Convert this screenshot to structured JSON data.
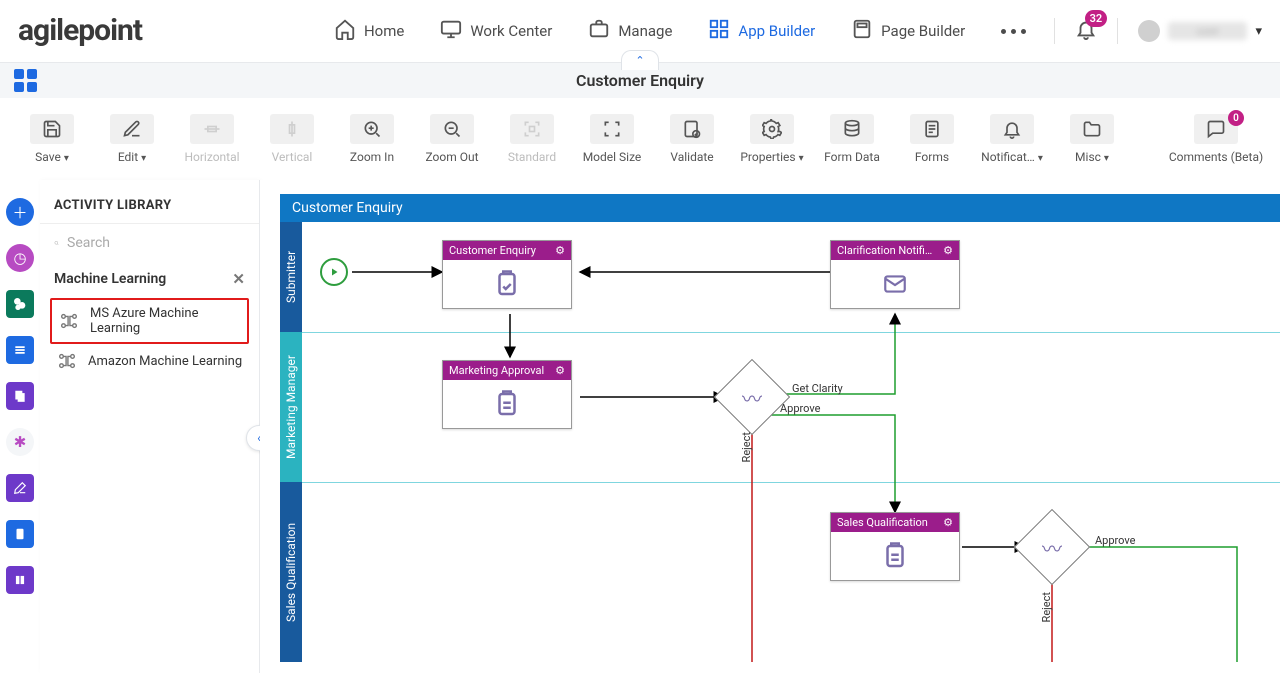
{
  "nav": {
    "logo": "agilepoint",
    "items": [
      {
        "label": "Home"
      },
      {
        "label": "Work Center"
      },
      {
        "label": "Manage"
      },
      {
        "label": "App Builder"
      },
      {
        "label": "Page Builder"
      }
    ],
    "notif_count": "32"
  },
  "process": {
    "title": "Customer Enquiry"
  },
  "toolbar": {
    "save": "Save",
    "edit": "Edit",
    "horizontal": "Horizontal",
    "vertical": "Vertical",
    "zoom_in": "Zoom In",
    "zoom_out": "Zoom Out",
    "standard": "Standard",
    "model_size": "Model Size",
    "validate": "Validate",
    "properties": "Properties",
    "form_data": "Form Data",
    "forms": "Forms",
    "notifications": "Notificat…",
    "misc": "Misc",
    "comments": "Comments (Beta)",
    "comments_badge": "0"
  },
  "library": {
    "header": "ACTIVITY LIBRARY",
    "search_ph": "Search",
    "category": "Machine Learning",
    "items": [
      {
        "label": "MS Azure Machine Learning"
      },
      {
        "label": "Amazon Machine Learning"
      }
    ]
  },
  "canvas": {
    "banner": "Customer Enquiry",
    "lanes": [
      "Submitter",
      "Marketing Manager",
      "Sales Qualification"
    ],
    "nodes": {
      "cust_enq": "Customer Enquiry",
      "clar_notif": "Clarification Notifi…",
      "mkt_appr": "Marketing Approval",
      "sales_qual": "Sales Qualification"
    },
    "labels": {
      "get_clarity": "Get Clarity",
      "approve1": "Approve",
      "reject1": "Reject",
      "approve2": "Approve",
      "reject2": "Reject"
    }
  }
}
